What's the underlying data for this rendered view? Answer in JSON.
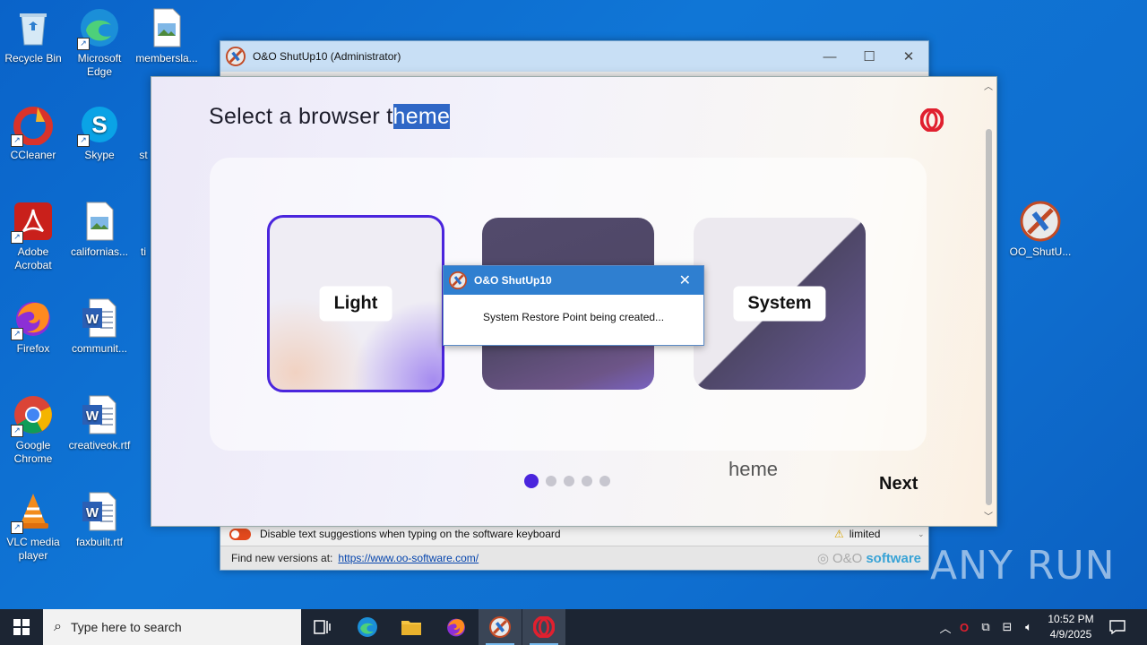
{
  "desktop": {
    "icons": [
      {
        "label": "Recycle Bin"
      },
      {
        "label": "Microsoft Edge"
      },
      {
        "label": "membersla..."
      },
      {
        "label": "CCleaner"
      },
      {
        "label": "Skype"
      },
      {
        "label": "st"
      },
      {
        "label": "Adobe Acrobat"
      },
      {
        "label": "californias..."
      },
      {
        "label": "ti"
      },
      {
        "label": "Firefox"
      },
      {
        "label": "communit..."
      },
      {
        "label": "Google Chrome"
      },
      {
        "label": "creativeok.rtf"
      },
      {
        "label": "VLC media player"
      },
      {
        "label": "faxbuilt.rtf"
      },
      {
        "label": "OO_ShutU..."
      }
    ]
  },
  "oo_window": {
    "title": "O&O ShutUp10 (Administrator)",
    "setting_label": "Disable text suggestions when typing on the software keyboard",
    "setting_status": "limited",
    "footer_label": "Find new versions at:",
    "footer_link": "https://www.oo-software.com/",
    "brand_prefix": "O&O",
    "brand_name": "software"
  },
  "opera": {
    "heading_prefix": "Select a browser t",
    "heading_selected": "heme",
    "themes": [
      {
        "label": "Light",
        "selected": true
      },
      {
        "label": "",
        "selected": false
      },
      {
        "label": "System",
        "selected": false
      }
    ],
    "ghost_text": "heme",
    "next_label": "Next",
    "page_count": 5,
    "active_page": 1,
    "accent": "#4a25dd"
  },
  "dialog": {
    "title": "O&O ShutUp10",
    "message": "System Restore Point being created..."
  },
  "taskbar": {
    "search_placeholder": "Type here to search",
    "time": "10:52 PM",
    "date": "4/9/2025"
  },
  "watermark": "ANY RUN"
}
